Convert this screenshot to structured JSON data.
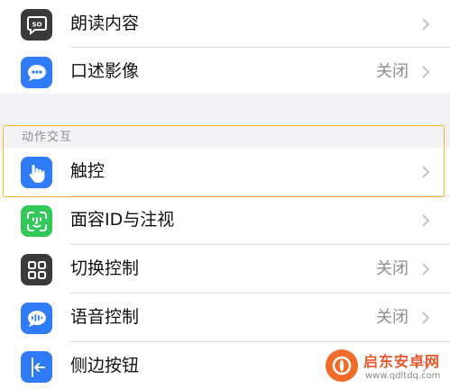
{
  "top_group": {
    "items": [
      {
        "label": "朗读内容",
        "value": "",
        "icon": "speech-bubble-icon"
      },
      {
        "label": "口述影像",
        "value": "关闭",
        "icon": "audio-description-icon"
      }
    ]
  },
  "section": {
    "header": "动作交互",
    "items": [
      {
        "label": "触控",
        "value": "",
        "icon": "hand-touch-icon"
      },
      {
        "label": "面容ID与注视",
        "value": "",
        "icon": "face-id-icon"
      },
      {
        "label": "切换控制",
        "value": "关闭",
        "icon": "switch-control-icon"
      },
      {
        "label": "语音控制",
        "value": "关闭",
        "icon": "voice-control-icon"
      },
      {
        "label": "侧边按钮",
        "value": "",
        "icon": "side-button-icon"
      }
    ]
  },
  "colors": {
    "blue": "#2f7cf6",
    "green": "#34c759",
    "dark": "#3a3a3c",
    "highlight": "#f5b62a"
  },
  "watermark": {
    "title": "启东安卓网",
    "url": "www.qdltdq.com"
  }
}
